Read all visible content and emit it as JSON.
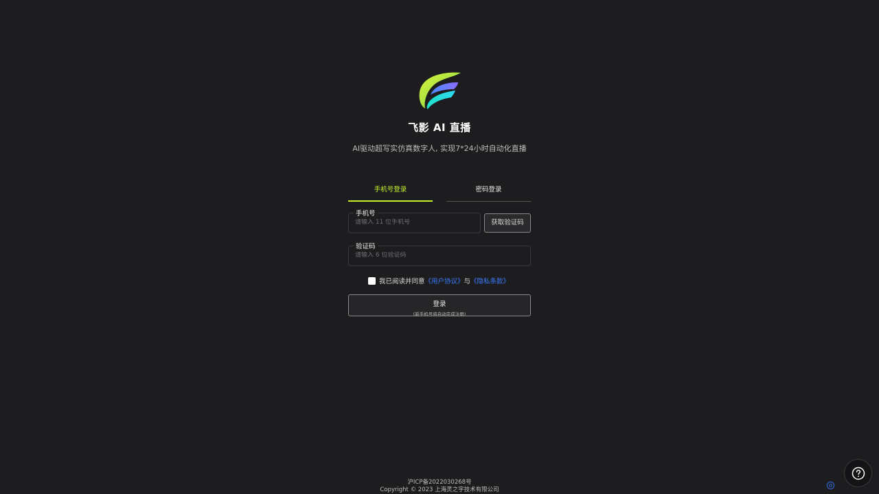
{
  "app": {
    "title": "飞影 AI 直播",
    "subtitle": "AI驱动超写实仿真数字人, 实现7*24小时自动化直播"
  },
  "tabs": [
    {
      "label": "手机号登录",
      "active": true
    },
    {
      "label": "密码登录",
      "active": false
    }
  ],
  "form": {
    "phone": {
      "label": "手机号",
      "placeholder": "请输入 11 位手机号",
      "value": ""
    },
    "code": {
      "label": "验证码",
      "placeholder": "请输入 6 位验证码",
      "value": ""
    },
    "get_code_label": "获取验证码",
    "agreement": {
      "prefix": "我已阅读并同意",
      "user_agreement": "《用户协议》",
      "and": "与",
      "privacy": "《隐私条款》",
      "checked": false
    },
    "login_label": "登录",
    "login_note": "(新手机号将自动完成注册)"
  },
  "footer": {
    "icp": "沪ICP备2022030268号",
    "copyright": "Copyright © 2023 上海灵之宇技术有限公司"
  },
  "icons": {
    "logo": "app-logo",
    "help": "question-circle-icon",
    "small": "settings-icon"
  },
  "colors": {
    "accent": "#c6f22c",
    "link": "#3b7bff",
    "background": "#1d1d1f"
  }
}
